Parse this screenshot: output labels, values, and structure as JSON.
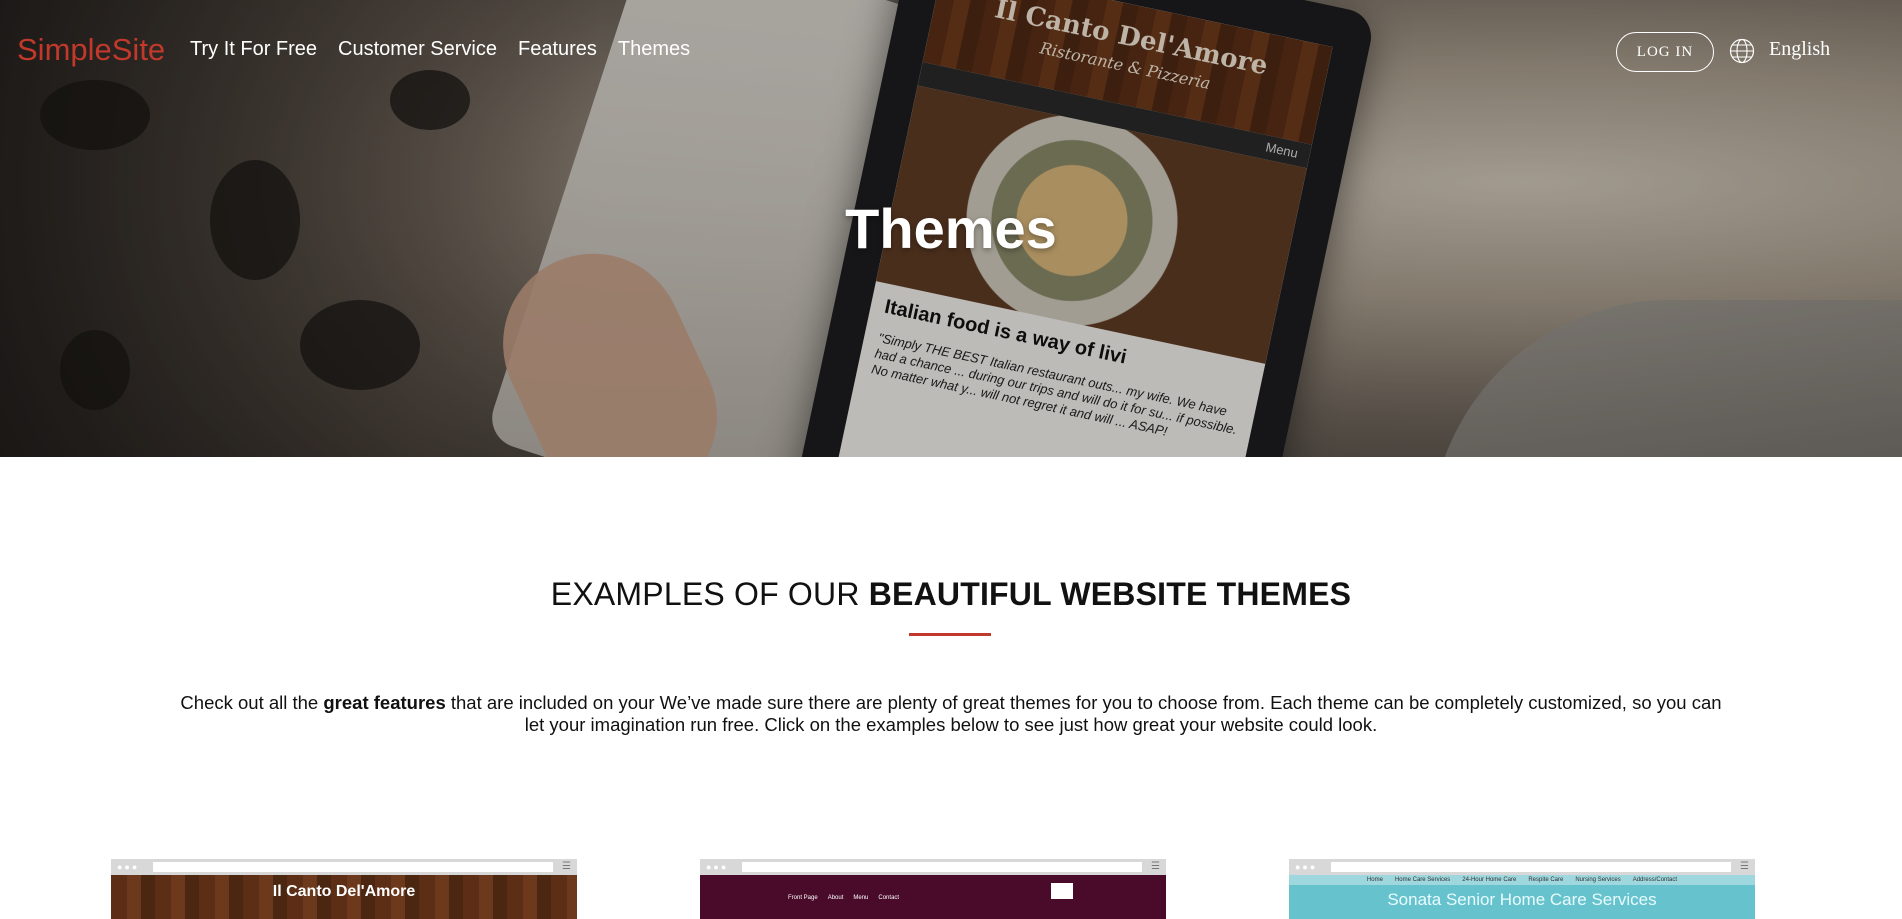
{
  "nav": {
    "logo": "SimpleSite",
    "links": [
      "Try It For Free",
      "Customer Service",
      "Features",
      "Themes"
    ],
    "login": "LOG IN",
    "language": "English",
    "globe_icon": "globe-icon"
  },
  "hero": {
    "title": "Themes",
    "tablet": {
      "site_name": "Il Canto Del'Amore",
      "site_tagline": "Ristorante & Pizzeria",
      "menu": "Menu",
      "headline": "Italian food is a way of livi",
      "body": "\"Simply THE BEST Italian restaurant outs... my wife. We have had a chance ... during our trips and will do it for su... if possible. No matter what y... will not regret it and will ... ASAP!"
    }
  },
  "section": {
    "heading_light": "EXAMPLES OF OUR ",
    "heading_bold": "BEAUTIFUL WEBSITE THEMES",
    "accent_color": "#c0392b",
    "intro_pre": "Check out all the ",
    "intro_bold": "great features",
    "intro_post": " that are included on your We’ve made sure there are plenty of great themes for you to choose from. Each theme can be completely customized, so you can let your imagination run free. Click on the examples below to see just how great your website could look."
  },
  "themes": [
    {
      "title": "Il Canto Del'Amore"
    },
    {
      "nav": [
        "Front Page",
        "About",
        "Menu",
        "Contact"
      ]
    },
    {
      "nav": [
        "Home",
        "Home Care Services",
        "24-Hour Home Care",
        "Respite Care",
        "Nursing Services",
        "Address/Contact"
      ],
      "title": "Sonata Senior Home Care Services"
    }
  ]
}
